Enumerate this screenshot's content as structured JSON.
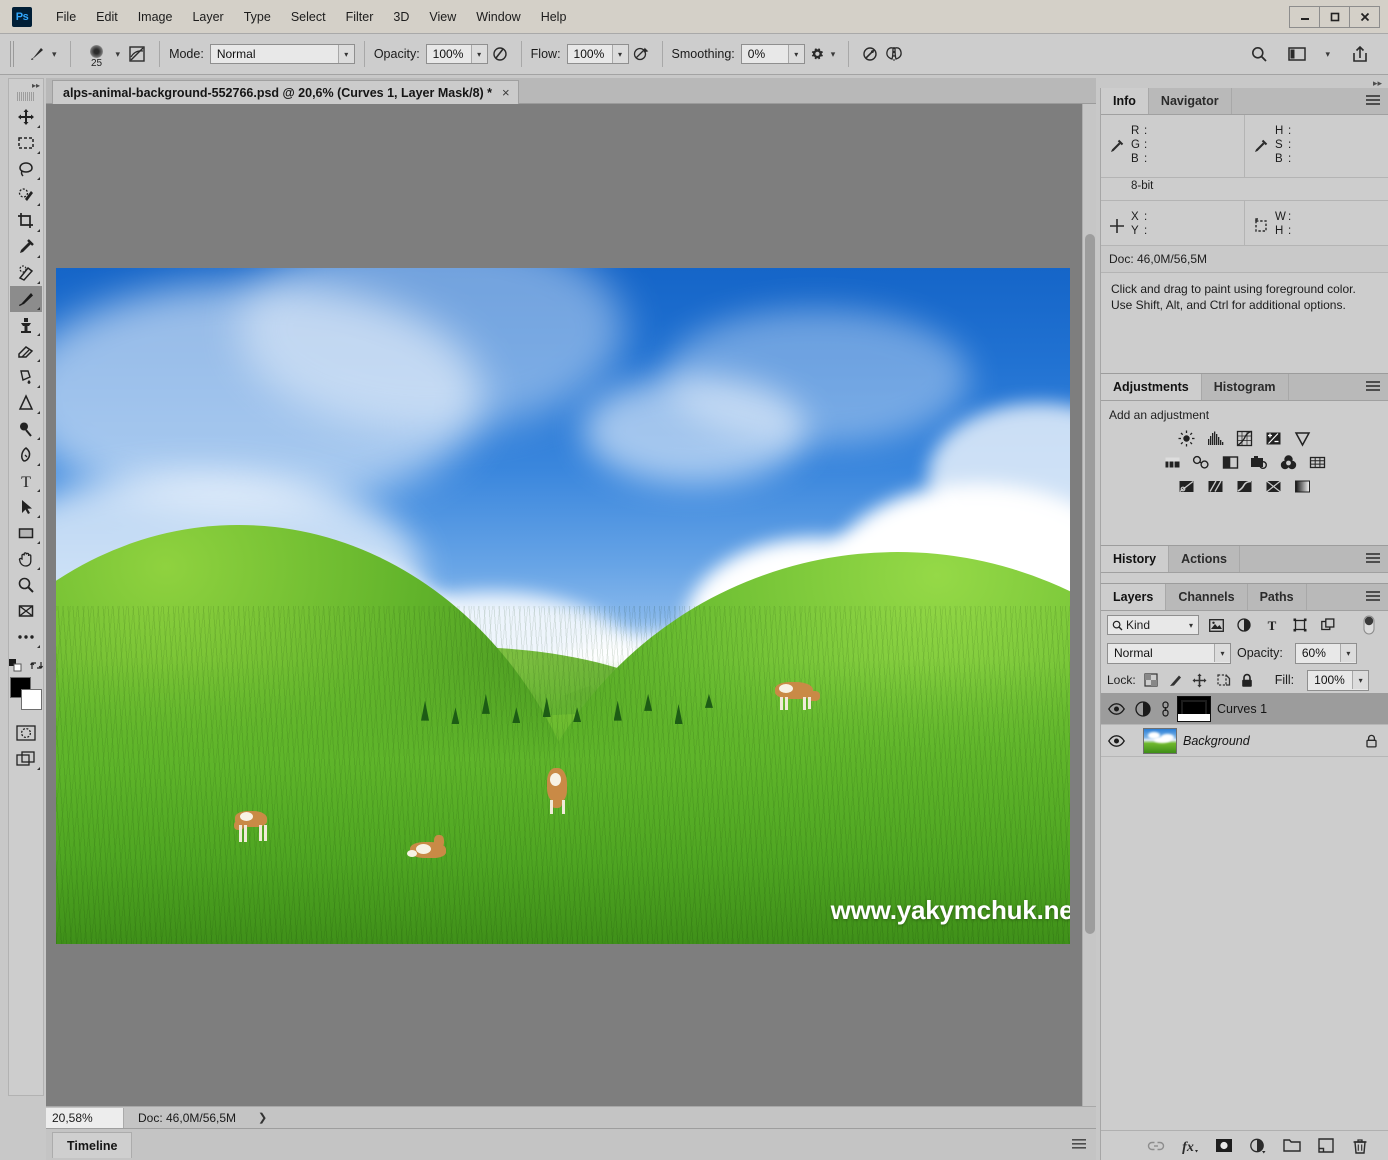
{
  "app": {
    "name": "Ps",
    "window_controls": [
      "minimize",
      "maximize",
      "close"
    ]
  },
  "menubar": {
    "items": [
      "File",
      "Edit",
      "Image",
      "Layer",
      "Type",
      "Select",
      "Filter",
      "3D",
      "View",
      "Window",
      "Help"
    ]
  },
  "options_bar": {
    "tool_icon": "brush-icon",
    "brush_size": "25",
    "mode_label": "Mode:",
    "mode_value": "Normal",
    "opacity_label": "Opacity:",
    "opacity_value": "100%",
    "airbrush_icon": "airbrush-icon",
    "flow_label": "Flow:",
    "flow_value": "100%",
    "smoothing_label": "Smoothing:",
    "smoothing_value": "0%",
    "settings_icon": "gear-icon",
    "tablet_pressure_icon": "pressure-opacity-icon",
    "symmetry_icon": "symmetry-butterfly-icon",
    "search_icon": "search-icon",
    "workspace_icon": "workspace-icon",
    "share_icon": "share-icon"
  },
  "toolbar": {
    "tools": [
      {
        "name": "move-tool",
        "active": false
      },
      {
        "name": "rectangular-marquee-tool",
        "active": false
      },
      {
        "name": "lasso-tool",
        "active": false
      },
      {
        "name": "quick-selection-tool",
        "active": false
      },
      {
        "name": "crop-tool",
        "active": false
      },
      {
        "name": "eyedropper-tool",
        "active": false
      },
      {
        "name": "spot-healing-brush-tool",
        "active": false
      },
      {
        "name": "brush-tool",
        "active": true
      },
      {
        "name": "clone-stamp-tool",
        "active": false
      },
      {
        "name": "eraser-tool",
        "active": false
      },
      {
        "name": "gradient-tool",
        "active": false
      },
      {
        "name": "blur-tool",
        "active": false
      },
      {
        "name": "dodge-tool",
        "active": false
      },
      {
        "name": "pen-tool",
        "active": false
      },
      {
        "name": "type-tool",
        "active": false
      },
      {
        "name": "path-selection-tool",
        "active": false
      },
      {
        "name": "rectangle-tool",
        "active": false
      },
      {
        "name": "hand-tool",
        "active": false
      },
      {
        "name": "zoom-tool",
        "active": false
      },
      {
        "name": "edit-toolbar-tool",
        "active": false
      },
      {
        "name": "more-tools",
        "active": false
      }
    ],
    "foreground_color": "#000000",
    "background_color": "#ffffff"
  },
  "document": {
    "tab_title": "alps-animal-background-552766.psd @ 20,6% (Curves 1, Layer Mask/8) *",
    "close_label": "×",
    "watermark": "www.yakymchuk.net"
  },
  "status_bar": {
    "zoom": "20,58%",
    "doc_size": "Doc: 46,0M/56,5M",
    "expand_arrow": "❯"
  },
  "timeline": {
    "tab_label": "Timeline",
    "menu_icon": "panel-menu-icon"
  },
  "info_panel": {
    "tabs": [
      {
        "label": "Info",
        "active": true
      },
      {
        "label": "Navigator",
        "active": false
      }
    ],
    "rgb": {
      "icon": "eyedropper-icon",
      "rows": [
        {
          "key": "R",
          "colon": ":",
          "value": ""
        },
        {
          "key": "G",
          "colon": ":",
          "value": ""
        },
        {
          "key": "B",
          "colon": ":",
          "value": ""
        }
      ]
    },
    "hsb": {
      "icon": "eyedropper-icon",
      "rows": [
        {
          "key": "H",
          "colon": ":",
          "value": ""
        },
        {
          "key": "S",
          "colon": ":",
          "value": ""
        },
        {
          "key": "B",
          "colon": ":",
          "value": ""
        }
      ]
    },
    "bit_depth": "8-bit",
    "xy": {
      "icon": "crosshair-icon",
      "rows": [
        {
          "key": "X",
          "colon": ":",
          "value": ""
        },
        {
          "key": "Y",
          "colon": ":",
          "value": ""
        }
      ]
    },
    "wh": {
      "icon": "marquee-icon",
      "rows": [
        {
          "key": "W",
          "colon": ":",
          "value": ""
        },
        {
          "key": "H",
          "colon": ":",
          "value": ""
        }
      ]
    },
    "doc_line": "Doc: 46,0M/56,5M",
    "hint_line1": "Click and drag to paint using foreground color.",
    "hint_line2": "Use Shift, Alt, and Ctrl for additional options."
  },
  "adjustments_panel": {
    "tabs": [
      {
        "label": "Adjustments",
        "active": true
      },
      {
        "label": "Histogram",
        "active": false
      }
    ],
    "heading": "Add an adjustment",
    "row1": [
      "brightness-contrast-icon",
      "levels-icon",
      "curves-icon",
      "exposure-icon",
      "vibrance-icon"
    ],
    "row2": [
      "hue-saturation-icon",
      "color-balance-icon",
      "black-and-white-icon",
      "photo-filter-icon",
      "channel-mixer-icon",
      "color-lookup-icon"
    ],
    "row3": [
      "invert-icon",
      "posterize-icon",
      "threshold-icon",
      "selective-color-icon",
      "gradient-map-icon"
    ]
  },
  "history_panel": {
    "tabs": [
      {
        "label": "History",
        "active": true
      },
      {
        "label": "Actions",
        "active": false
      }
    ]
  },
  "layers_panel": {
    "tabs": [
      {
        "label": "Layers",
        "active": true
      },
      {
        "label": "Channels",
        "active": false
      },
      {
        "label": "Paths",
        "active": false
      }
    ],
    "filter_kind": "Kind",
    "filter_icons": [
      "filter-pixel-icon",
      "filter-adjustment-icon",
      "filter-type-icon",
      "filter-shape-icon",
      "filter-smart-object-icon"
    ],
    "filter_toggle": "filter-enable-toggle",
    "blend_mode": "Normal",
    "opacity_label": "Opacity:",
    "opacity_value": "60%",
    "lock_label": "Lock:",
    "lock_icons": [
      "lock-transparent-pixels-icon",
      "lock-image-pixels-icon",
      "lock-position-icon",
      "lock-artboard-nesting-icon",
      "lock-all-icon"
    ],
    "fill_label": "Fill:",
    "fill_value": "100%",
    "layers": [
      {
        "name": "Curves 1",
        "visible": true,
        "selected": true,
        "italic": false,
        "thumb_type": "adjustment",
        "has_mask": true,
        "linked": true,
        "locked": false
      },
      {
        "name": "Background",
        "visible": true,
        "selected": false,
        "italic": true,
        "thumb_type": "photo",
        "has_mask": false,
        "linked": false,
        "locked": true
      }
    ],
    "bottom_icons": [
      "link-layers-icon",
      "add-layer-style-icon",
      "add-layer-mask-icon",
      "new-adjustment-layer-icon",
      "new-group-icon",
      "new-layer-icon",
      "delete-layer-icon"
    ]
  },
  "colors": {
    "chrome": "#cdcdcd",
    "canvas_bg": "#7e7e7e",
    "tab_active": "#cbcbcb",
    "selection": "#9c9c9c",
    "accent_blue": "#31a8ff"
  }
}
